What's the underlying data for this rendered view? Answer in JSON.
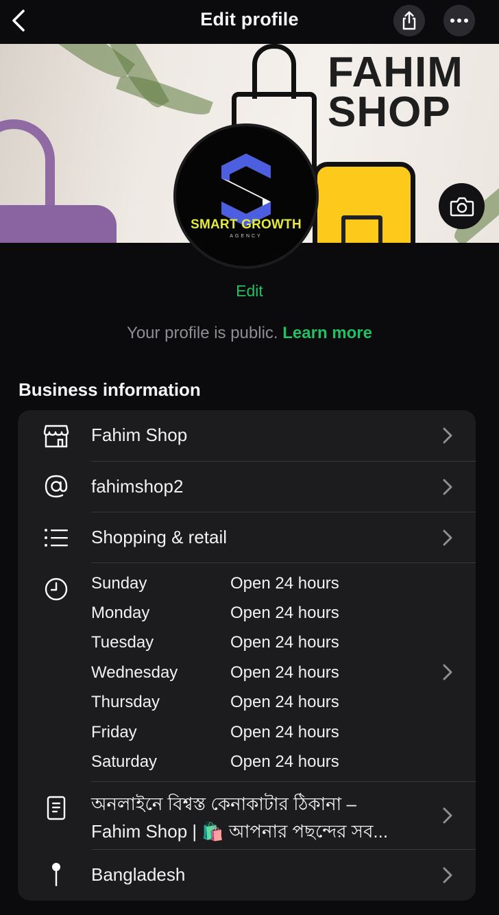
{
  "nav": {
    "title": "Edit profile",
    "back_icon": "chevron-left-icon",
    "share_icon": "share-icon",
    "more_icon": "more-horizontal-icon"
  },
  "cover": {
    "brand_line1": "FAHIM",
    "brand_line2": "SHOP",
    "camera_icon": "camera-icon"
  },
  "avatar": {
    "name": "SMART GROWTH",
    "sub": "AGENCY"
  },
  "profile": {
    "edit_label": "Edit",
    "public_text": "Your profile is public.",
    "learn_more": "Learn more"
  },
  "business": {
    "section_title": "Business information",
    "name": "Fahim Shop",
    "username": "fahimshop2",
    "category": "Shopping & retail",
    "hours": [
      {
        "day": "Sunday",
        "value": "Open 24 hours"
      },
      {
        "day": "Monday",
        "value": "Open 24 hours"
      },
      {
        "day": "Tuesday",
        "value": "Open 24 hours"
      },
      {
        "day": "Wednesday",
        "value": "Open 24 hours"
      },
      {
        "day": "Thursday",
        "value": "Open 24 hours"
      },
      {
        "day": "Friday",
        "value": "Open 24 hours"
      },
      {
        "day": "Saturday",
        "value": "Open 24 hours"
      }
    ],
    "description_line1": "অনলাইনে বিশ্বস্ত কেনাকাটার ঠিকানা –",
    "description_line2": "Fahim Shop | 🛍️ আপনার পছন্দের সব...",
    "location": "Bangladesh"
  },
  "colors": {
    "accent": "#21c063",
    "background": "#0b0b0d",
    "card": "#1c1c1e"
  }
}
